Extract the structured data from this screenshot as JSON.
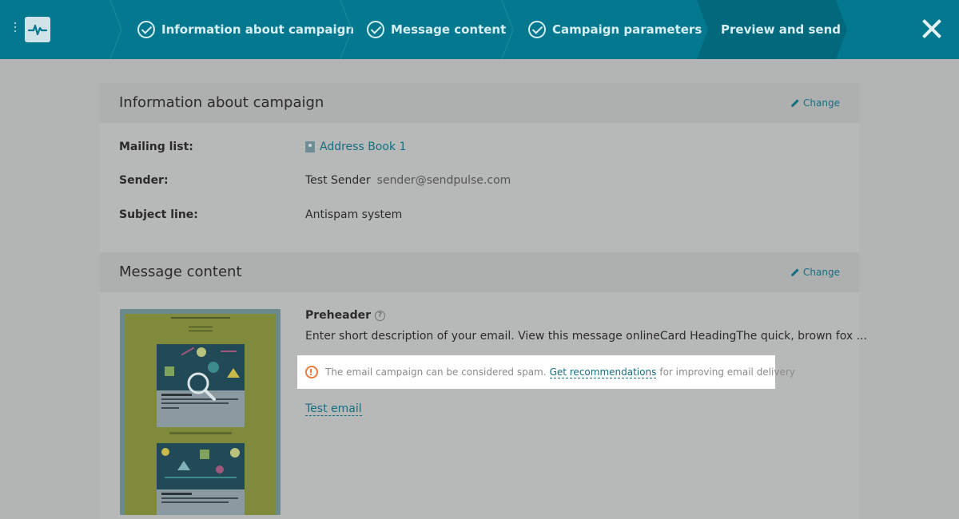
{
  "steps": [
    {
      "label": "Information about campaign",
      "done": true
    },
    {
      "label": "Message content",
      "done": true
    },
    {
      "label": "Campaign parameters",
      "done": true
    },
    {
      "label": "Preview and send",
      "done": false,
      "active": true
    }
  ],
  "colors": {
    "topbar": "#03788e",
    "active_step": "#02687c",
    "accent_link": "#146f80",
    "warning": "#ea7b3d"
  },
  "info_section": {
    "title": "Information about campaign",
    "change_label": "Change",
    "rows": [
      {
        "label": "Mailing list:",
        "value": "Address Book 1"
      },
      {
        "label": "Sender:",
        "value": "Test Sender",
        "secondary": "sender@sendpulse.com"
      },
      {
        "label": "Subject line:",
        "value": "Antispam system"
      }
    ]
  },
  "message_section": {
    "title": "Message content",
    "change_label": "Change",
    "preheader_label": "Preheader",
    "preheader_text": "Enter short description of your email. View this message onlineCard HeadingThe quick, brown fox ...",
    "spam_warning": {
      "before": "The email campaign can be considered spam.",
      "link": "Get recommendations",
      "after": "for improving email delivery"
    },
    "test_email_label": "Test email",
    "thumbnail": {
      "card1_heading": "Card Heading",
      "card2_heading": "Card Heading"
    }
  },
  "icons": [
    "menu-dots-icon",
    "pulse-logo-icon",
    "check-circle-icon",
    "close-icon",
    "pencil-icon",
    "address-book-icon",
    "help-icon",
    "warning-icon",
    "zoom-icon"
  ]
}
